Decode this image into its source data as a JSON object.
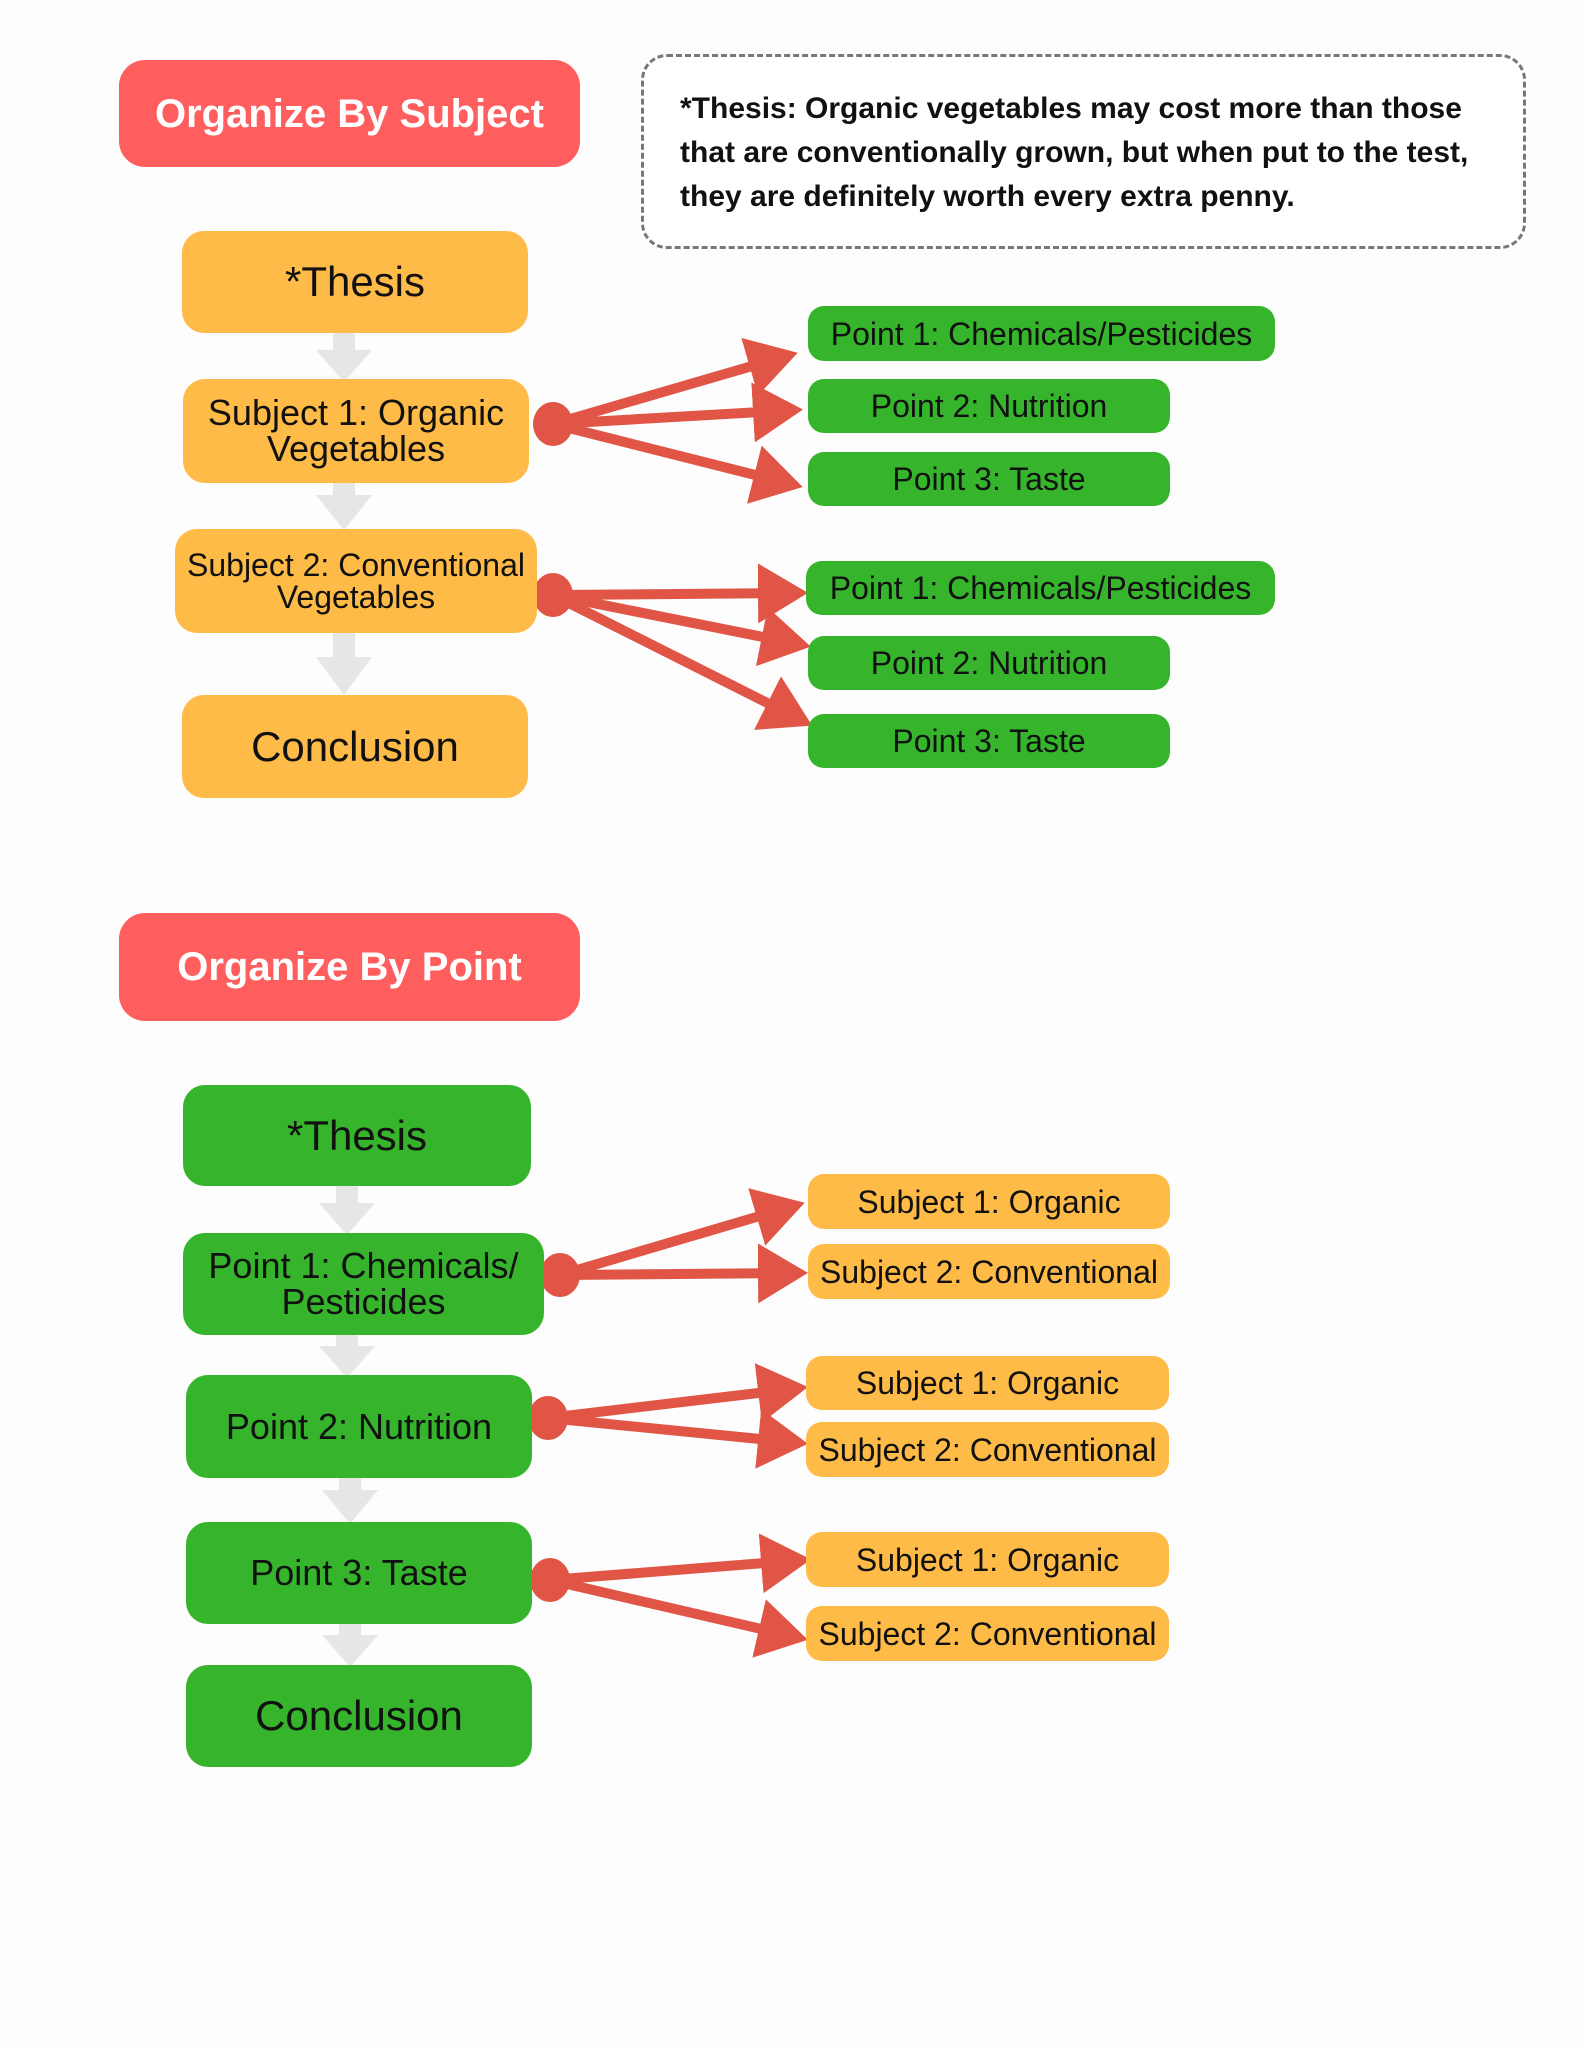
{
  "colors": {
    "header": "#ff5e5e",
    "orange": "#ffbb47",
    "green": "#36b52c",
    "arrow": "#e05545",
    "connector": "#e6e6e6"
  },
  "section_subject": {
    "header": "Organize By Subject",
    "thesis_note": "*Thesis: Organic vegetables may cost more than those that are conventionally grown, but when put to the test, they are definitely worth every extra penny.",
    "flow": [
      "*Thesis",
      "Subject 1: Organic Vegetables",
      "Subject 2: Conventional Vegetables",
      "Conclusion"
    ],
    "subject1_points": [
      "Point 1: Chemicals/Pesticides",
      "Point 2: Nutrition",
      "Point 3: Taste"
    ],
    "subject2_points": [
      "Point 1: Chemicals/Pesticides",
      "Point 2: Nutrition",
      "Point 3: Taste"
    ]
  },
  "section_point": {
    "header": "Organize By Point",
    "flow": [
      "*Thesis",
      "Point 1: Chemicals/ Pesticides",
      "Point 2: Nutrition",
      "Point 3: Taste",
      "Conclusion"
    ],
    "point1_subjects": [
      "Subject 1: Organic",
      "Subject 2: Conventional"
    ],
    "point2_subjects": [
      "Subject 1: Organic",
      "Subject 2: Conventional"
    ],
    "point3_subjects": [
      "Subject 1: Organic",
      "Subject 2: Conventional"
    ]
  }
}
